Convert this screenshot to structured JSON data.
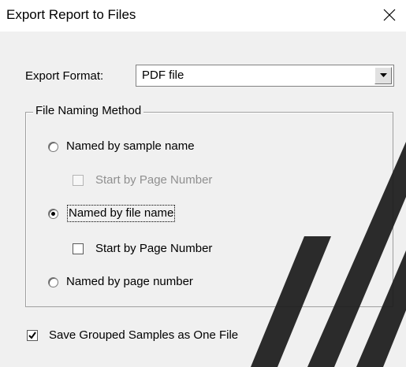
{
  "window": {
    "title": "Export Report to Files",
    "close_icon": "close-icon"
  },
  "export_format": {
    "label": "Export Format:",
    "selected": "PDF file",
    "dropdown_icon": "chevron-down-icon"
  },
  "file_naming": {
    "legend": "File Naming Method",
    "options": [
      {
        "label": "Named by sample name",
        "checked": false
      },
      {
        "label": "Named by file name",
        "checked": true
      },
      {
        "label": "Named by page number",
        "checked": false
      }
    ],
    "sample_start_by_page": {
      "label": "Start by Page Number",
      "checked": false,
      "disabled": true
    },
    "file_start_by_page": {
      "label": "Start by Page Number",
      "checked": false,
      "disabled": false
    }
  },
  "save_grouped": {
    "label": "Save Grouped Samples as One File",
    "checked": true
  },
  "colors": {
    "dialog_bg": "#f0f0f0",
    "titlebar_bg": "#ffffff",
    "disabled_text": "#8f8f8f",
    "watermark": "#1a1a1a"
  }
}
